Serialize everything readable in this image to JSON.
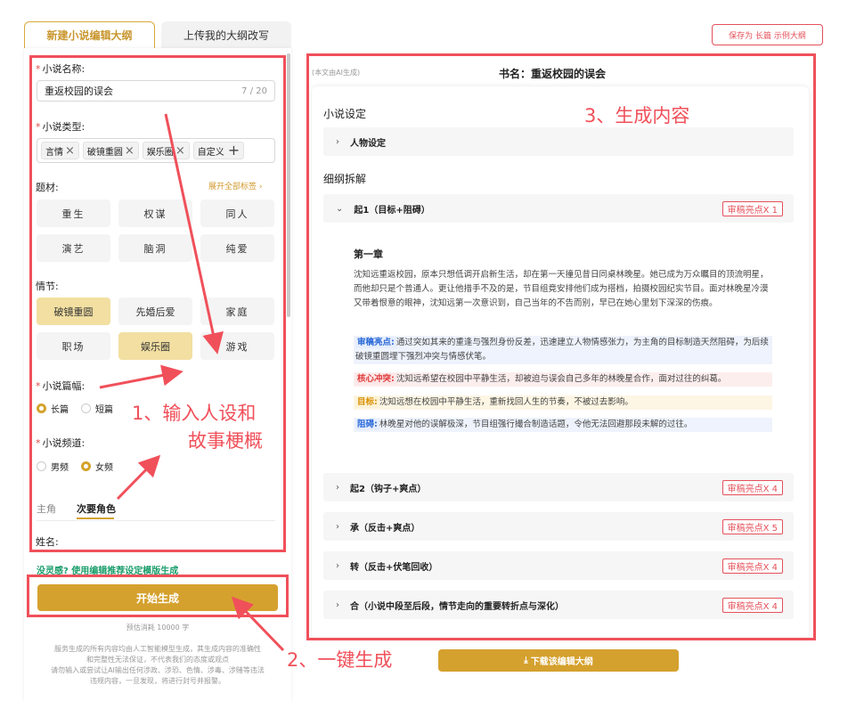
{
  "tabs": {
    "new_outline": "新建小说编辑大纲",
    "upload_outline": "上传我的大纲改写"
  },
  "save_button": "保存为 长篇 示例大纲",
  "form": {
    "name_label": "小说名称:",
    "name_value": "重返校园的误会",
    "name_count": "7 / 20",
    "type_label": "小说类型:",
    "type_tags": [
      "言情",
      "破镜重圆",
      "娱乐圈"
    ],
    "custom_tag": "自定义",
    "theme_label": "题材:",
    "expand_all": "展开全部标签",
    "themes": [
      "重生",
      "权谋",
      "同人",
      "演艺",
      "脑洞",
      "纯爱"
    ],
    "plot_label": "情节:",
    "plots": [
      "破镜重圆",
      "先婚后爱",
      "家庭",
      "职场",
      "娱乐圈",
      "游戏"
    ],
    "length_label": "小说篇幅:",
    "length_options": [
      "长篇",
      "短篇"
    ],
    "channel_label": "小说频道:",
    "channel_options": [
      "男频",
      "女频"
    ],
    "role_tabs": [
      "主角",
      "次要角色"
    ],
    "name_field_label": "姓名:",
    "inspiration_link": "没灵感? 使用编辑推荐设定模版生成",
    "generate_button": "开始生成",
    "estimate": "预估消耗 10000 字",
    "disclaimer": [
      "服务生成的所有内容均由人工智能模型生成，其生成内容的准确性",
      "和完整性无法保证，不代表我们的态度或观点",
      "请勿输入或尝试让AI输出任何涉政、涉恐、色情、涉毒、涉赌等违法",
      "违规内容，一旦发现，将进行封号并报警。"
    ]
  },
  "annotations": {
    "input": [
      "1、输入人设和",
      "故事梗概"
    ],
    "generate": "2、一键生成",
    "output": "3、生成内容"
  },
  "output": {
    "ai_note": "(本文由AI生成)",
    "book_title": "书名：重返校园的误会",
    "setting_heading": "小说设定",
    "character_row": "人物设定",
    "breakdown_heading": "细纲拆解",
    "sections": [
      {
        "label": "起1（目标+阻碍）",
        "badge": "审稿亮点X 1"
      },
      {
        "label": "起2（钩子+爽点）",
        "badge": "审稿亮点X 4"
      },
      {
        "label": "承（反击+爽点）",
        "badge": "审稿亮点X 5"
      },
      {
        "label": "转（反击+伏笔回收）",
        "badge": "审稿亮点X 4"
      },
      {
        "label": "合（小说中段至后段，情节走向的重要转折点与深化）",
        "badge": "审稿亮点X 4"
      }
    ],
    "chapter_title": "第一章",
    "chapter_text": "沈知远重返校园，原本只想低调开启新生活，却在第一天撞见昔日同桌林晚星。她已成为万众瞩目的顶流明星，而他却只是个普通人。更让他措手不及的是，节目组竟安排他们成为搭档，拍摄校园纪实节目。面对林晚星冷漠又带着恨意的眼神，沈知远第一次意识到，自己当年的不告而别，早已在她心里划下深深的伤痕。",
    "highlights": [
      {
        "tag": "审稿亮点:",
        "text": "通过突如其来的重逢与强烈身份反差，迅速建立人物情感张力，为主角的目标制造天然阻碍，为后续破镜重圆埋下强烈冲突与情感伏笔。"
      },
      {
        "tag": "核心冲突:",
        "text": "沈知远希望在校园中平静生活，却被迫与误会自己多年的林晚星合作，面对过往的纠葛。"
      },
      {
        "tag": "目标:",
        "text": "沈知远想在校园中平静生活，重新找回人生的节奏，不被过去影响。"
      },
      {
        "tag": "阻碍:",
        "text": "林晚星对他的误解极深，节目组强行撮合制造话题，令他无法回避那段未解的过往。"
      }
    ],
    "download_button": "下载该编辑大纲"
  }
}
